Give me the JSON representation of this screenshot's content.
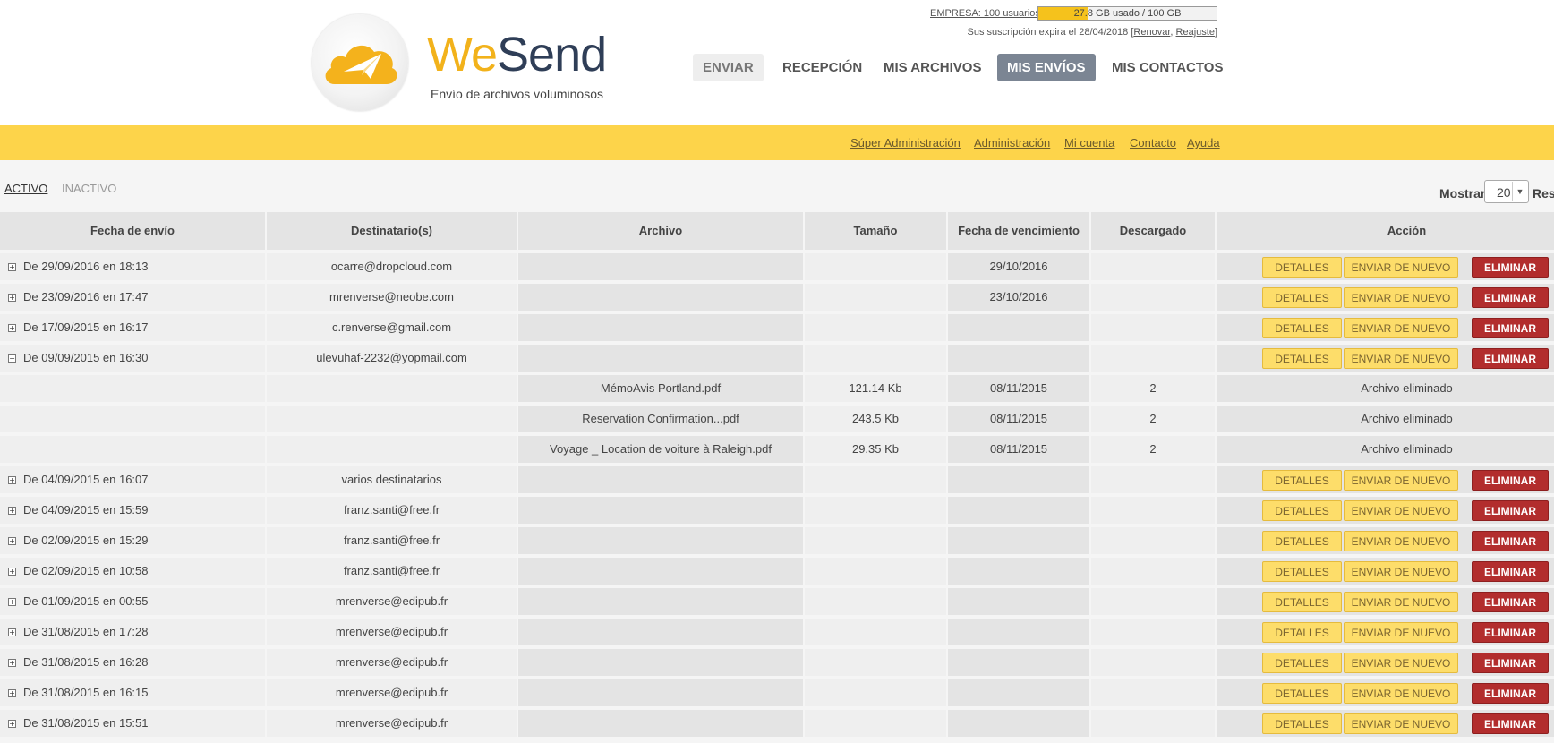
{
  "brand": {
    "we": "We",
    "send": "Send",
    "tagline": "Envío de archivos voluminosos"
  },
  "quota": {
    "company_link": "EMPRESA: 100 usuarios",
    "used_text": "27.8 GB usado / 100 GB",
    "used_fraction": 0.278
  },
  "expiry": {
    "text": "Sus suscripción expira el 28/04/2018 [",
    "renew": "Renovar",
    "sep": ",",
    "readjust": "Reajuste",
    "close": "]"
  },
  "nav": [
    {
      "label": "ENVIAR",
      "state": "soft"
    },
    {
      "label": "RECEPCIÓN",
      "state": "normal"
    },
    {
      "label": "MIS ARCHIVOS",
      "state": "normal"
    },
    {
      "label": "MIS ENVÍOS",
      "state": "active"
    },
    {
      "label": "MIS CONTACTOS",
      "state": "normal"
    }
  ],
  "toplinks": [
    "Súper Administración",
    "Administración",
    "Mi cuenta",
    "Contacto",
    "Ayuda"
  ],
  "tabs": {
    "active": "ACTIVO",
    "inactive": "INACTIVO"
  },
  "pager": {
    "show_label": "Mostrar",
    "show_value": "20",
    "results_label": "Resultados"
  },
  "columns": [
    "Fecha de envío",
    "Destinatario(s)",
    "Archivo",
    "Tamaño",
    "Fecha de vencimiento",
    "Descargado",
    "Acción"
  ],
  "buttons": {
    "details": "DETALLES",
    "resend": "ENVIAR DE NUEVO",
    "delete": "ELIMINAR"
  },
  "rows": [
    {
      "kind": "send",
      "expanded": false,
      "date": "De 29/09/2016 en 18:13",
      "recipient": "ocarre@dropcloud.com",
      "file": "",
      "size": "",
      "expires": "29/10/2016",
      "downloaded": ""
    },
    {
      "kind": "send",
      "expanded": false,
      "date": "De 23/09/2016 en 17:47",
      "recipient": "mrenverse@neobe.com",
      "file": "",
      "size": "",
      "expires": "23/10/2016",
      "downloaded": ""
    },
    {
      "kind": "send",
      "expanded": false,
      "date": "De 17/09/2015 en 16:17",
      "recipient": "c.renverse@gmail.com",
      "file": "",
      "size": "",
      "expires": "",
      "downloaded": ""
    },
    {
      "kind": "send",
      "expanded": true,
      "date": "De 09/09/2015 en 16:30",
      "recipient": "ulevuhaf-2232@yopmail.com",
      "file": "",
      "size": "",
      "expires": "",
      "downloaded": ""
    },
    {
      "kind": "file",
      "file": "MémoAvis Portland.pdf",
      "size": "121.14 Kb",
      "expires": "08/11/2015",
      "downloaded": "2",
      "action": "Archivo eliminado"
    },
    {
      "kind": "file",
      "file": "Reservation Confirmation...pdf",
      "size": "243.5 Kb",
      "expires": "08/11/2015",
      "downloaded": "2",
      "action": "Archivo eliminado"
    },
    {
      "kind": "file",
      "file": "Voyage _ Location de voiture à Raleigh.pdf",
      "size": "29.35 Kb",
      "expires": "08/11/2015",
      "downloaded": "2",
      "action": "Archivo eliminado"
    },
    {
      "kind": "send",
      "expanded": false,
      "date": "De 04/09/2015 en 16:07",
      "recipient": "varios destinatarios",
      "file": "",
      "size": "",
      "expires": "",
      "downloaded": ""
    },
    {
      "kind": "send",
      "expanded": false,
      "date": "De 04/09/2015 en 15:59",
      "recipient": "franz.santi@free.fr",
      "file": "",
      "size": "",
      "expires": "",
      "downloaded": ""
    },
    {
      "kind": "send",
      "expanded": false,
      "date": "De 02/09/2015 en 15:29",
      "recipient": "franz.santi@free.fr",
      "file": "",
      "size": "",
      "expires": "",
      "downloaded": ""
    },
    {
      "kind": "send",
      "expanded": false,
      "date": "De 02/09/2015 en 10:58",
      "recipient": "franz.santi@free.fr",
      "file": "",
      "size": "",
      "expires": "",
      "downloaded": ""
    },
    {
      "kind": "send",
      "expanded": false,
      "date": "De 01/09/2015 en 00:55",
      "recipient": "mrenverse@edipub.fr",
      "file": "",
      "size": "",
      "expires": "",
      "downloaded": ""
    },
    {
      "kind": "send",
      "expanded": false,
      "date": "De 31/08/2015 en 17:28",
      "recipient": "mrenverse@edipub.fr",
      "file": "",
      "size": "",
      "expires": "",
      "downloaded": ""
    },
    {
      "kind": "send",
      "expanded": false,
      "date": "De 31/08/2015 en 16:28",
      "recipient": "mrenverse@edipub.fr",
      "file": "",
      "size": "",
      "expires": "",
      "downloaded": ""
    },
    {
      "kind": "send",
      "expanded": false,
      "date": "De 31/08/2015 en 16:15",
      "recipient": "mrenverse@edipub.fr",
      "file": "",
      "size": "",
      "expires": "",
      "downloaded": ""
    },
    {
      "kind": "send",
      "expanded": false,
      "date": "De 31/08/2015 en 15:51",
      "recipient": "mrenverse@edipub.fr",
      "file": "",
      "size": "",
      "expires": "",
      "downloaded": ""
    }
  ]
}
